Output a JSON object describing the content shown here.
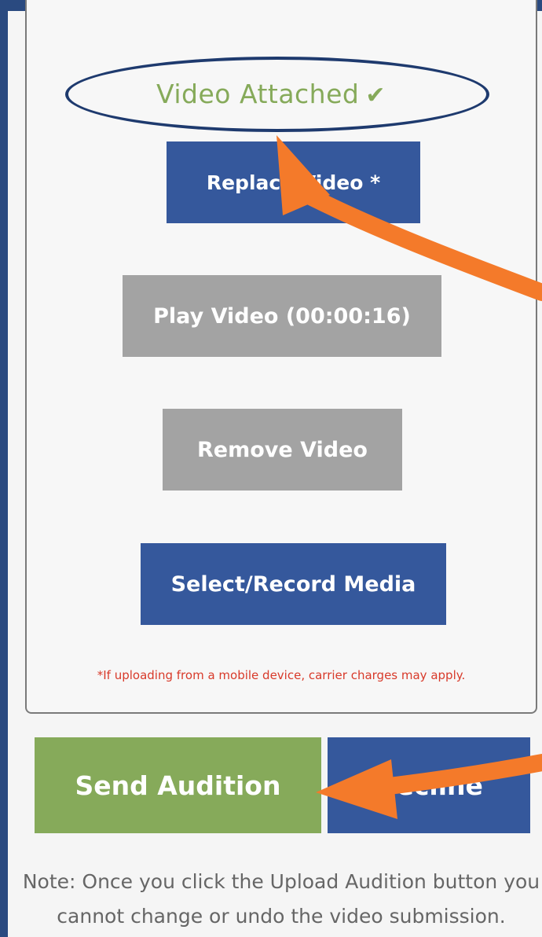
{
  "media_panel": {
    "status_text": "Video Attached",
    "status_icon": "check-icon",
    "replace_label": "Replace Video *",
    "play_label": "Play Video (00:00:16)",
    "remove_label": "Remove Video",
    "select_label": "Select/Record Media",
    "disclaimer": "*If uploading from a mobile device, carrier charges may apply."
  },
  "actions": {
    "send_label": "Send Audition",
    "decline_label": "Decline"
  },
  "note": {
    "text": "Note: Once you click the Upload Audition button you cannot change or undo the video submission."
  },
  "colors": {
    "brand_blue": "#35589c",
    "gray_button": "#a3a3a3",
    "green": "#86aa5a",
    "disclaimer_red": "#d83a2a",
    "annotation_orange": "#f47a2a",
    "annotation_navy": "#1e3a6e"
  }
}
